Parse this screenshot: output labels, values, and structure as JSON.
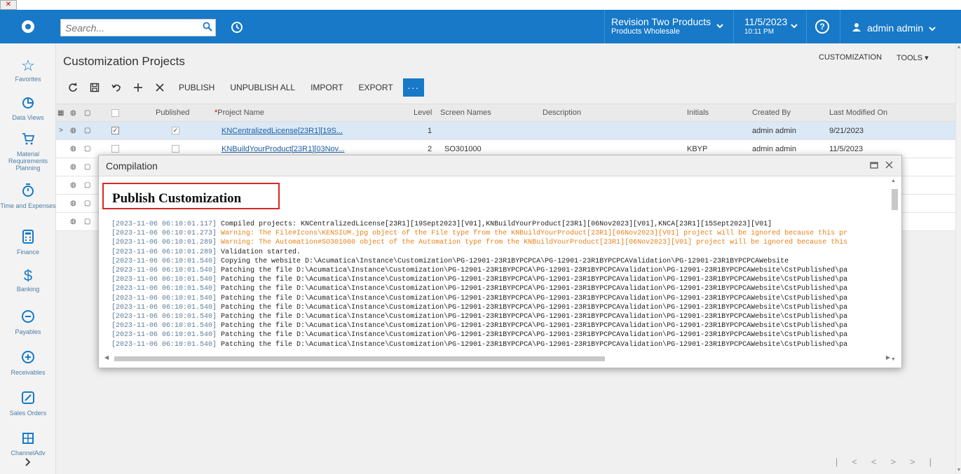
{
  "broken_image": "✕",
  "topbar": {
    "search_placeholder": "Search...",
    "tenant_line1": "Revision Two Products",
    "tenant_line2": "Products Wholesale",
    "date": "11/5/2023",
    "time": "10:11 PM",
    "help": "?",
    "user": "admin admin"
  },
  "sidebar": {
    "items": [
      {
        "label": "Favorites",
        "icon": "star-icon"
      },
      {
        "label": "Data Views",
        "icon": "pie-chart-icon"
      },
      {
        "label": "Material Requirements Planning",
        "icon": "cart-icon"
      },
      {
        "label": "Time and Expenses",
        "icon": "stopwatch-icon"
      },
      {
        "label": "Finance",
        "icon": "calculator-icon"
      },
      {
        "label": "Banking",
        "icon": "dollar-icon"
      },
      {
        "label": "Payables",
        "icon": "minus-circle-icon"
      },
      {
        "label": "Receivables",
        "icon": "plus-circle-icon"
      },
      {
        "label": "Sales Orders",
        "icon": "pencil-icon"
      },
      {
        "label": "ChannelAdv",
        "icon": "grid-icon"
      }
    ]
  },
  "page": {
    "title": "Customization Projects",
    "customization": "CUSTOMIZATION",
    "tools": "TOOLS ▾"
  },
  "toolbar": {
    "publish": "PUBLISH",
    "unpublish_all": "UNPUBLISH ALL",
    "import": "IMPORT",
    "export": "EXPORT",
    "more": "···"
  },
  "grid": {
    "columns": {
      "published": "Published",
      "project_name": "Project Name",
      "level": "Level",
      "screen_names": "Screen Names",
      "description": "Description",
      "initials": "Initials",
      "created_by": "Created By",
      "last_modified": "Last Modified On"
    },
    "rows": [
      {
        "project_name": "KNCentralizedLicense[23R1][19S...",
        "level": "1",
        "screen_names": "",
        "initials": "",
        "created_by": "admin admin",
        "last_modified": "9/21/2023"
      },
      {
        "project_name": "KNBuildYourProduct[23R1][03Nov...",
        "level": "2",
        "screen_names": "SO301000",
        "initials": "KBYP",
        "created_by": "admin admin",
        "last_modified": "11/5/2023"
      }
    ]
  },
  "modal": {
    "title": "Compilation",
    "heading": "Publish Customization",
    "log": [
      {
        "ts": "[2023-11-06 06:10:01.117]",
        "text": " Compiled projects: KNCentralizedLicense[23R1][19Sept2023][V01],KNBuildYourProduct[23R1][06Nov2023][V01],KNCA[23R1][15Sept2023][V01]",
        "warn": false
      },
      {
        "ts": "[2023-11-06 06:10:01.273]",
        "text": " Warning: The File#Icons\\KENSIUM.jpg object of the File type from the KNBuildYourProduct[23R1][06Nov2023][V01] project will be ignored because this pr",
        "warn": true
      },
      {
        "ts": "[2023-11-06 06:10:01.289]",
        "text": " Warning: The Automation#SO301000 object of the Automation type from the KNBuildYourProduct[23R1][06Nov2023][V01] project will be ignored because this",
        "warn": true
      },
      {
        "ts": "[2023-11-06 06:10:01.289]",
        "text": " Validation started.",
        "warn": false
      },
      {
        "ts": "[2023-11-06 06:10:01.540]",
        "text": " Copying the website D:\\Acumatica\\Instance\\Customization\\PG-12901-23R1BYPCPCA\\PG-12901-23R1BYPCPCAValidation\\PG-12901-23R1BYPCPCAWebsite",
        "warn": false
      },
      {
        "ts": "[2023-11-06 06:10:01.540]",
        "text": " Patching the file D:\\Acumatica\\Instance\\Customization\\PG-12901-23R1BYPCPCA\\PG-12901-23R1BYPCPCAValidation\\PG-12901-23R1BYPCPCAWebsite\\CstPublished\\pa",
        "warn": false
      },
      {
        "ts": "[2023-11-06 06:10:01.540]",
        "text": " Patching the file D:\\Acumatica\\Instance\\Customization\\PG-12901-23R1BYPCPCA\\PG-12901-23R1BYPCPCAValidation\\PG-12901-23R1BYPCPCAWebsite\\CstPublished\\pa",
        "warn": false
      },
      {
        "ts": "[2023-11-06 06:10:01.540]",
        "text": " Patching the file D:\\Acumatica\\Instance\\Customization\\PG-12901-23R1BYPCPCA\\PG-12901-23R1BYPCPCAValidation\\PG-12901-23R1BYPCPCAWebsite\\CstPublished\\pa",
        "warn": false
      },
      {
        "ts": "[2023-11-06 06:10:01.540]",
        "text": " Patching the file D:\\Acumatica\\Instance\\Customization\\PG-12901-23R1BYPCPCA\\PG-12901-23R1BYPCPCAValidation\\PG-12901-23R1BYPCPCAWebsite\\CstPublished\\pa",
        "warn": false
      },
      {
        "ts": "[2023-11-06 06:10:01.540]",
        "text": " Patching the file D:\\Acumatica\\Instance\\Customization\\PG-12901-23R1BYPCPCA\\PG-12901-23R1BYPCPCAValidation\\PG-12901-23R1BYPCPCAWebsite\\CstPublished\\pa",
        "warn": false
      },
      {
        "ts": "[2023-11-06 06:10:01.540]",
        "text": " Patching the file D:\\Acumatica\\Instance\\Customization\\PG-12901-23R1BYPCPCA\\PG-12901-23R1BYPCPCAValidation\\PG-12901-23R1BYPCPCAWebsite\\CstPublished\\pa",
        "warn": false
      },
      {
        "ts": "[2023-11-06 06:10:01.540]",
        "text": " Patching the file D:\\Acumatica\\Instance\\Customization\\PG-12901-23R1BYPCPCA\\PG-12901-23R1BYPCPCAValidation\\PG-12901-23R1BYPCPCAWebsite\\CstPublished\\pa",
        "warn": false
      },
      {
        "ts": "[2023-11-06 06:10:01.540]",
        "text": " Patching the file D:\\Acumatica\\Instance\\Customization\\PG-12901-23R1BYPCPCA\\PG-12901-23R1BYPCPCAValidation\\PG-12901-23R1BYPCPCAWebsite\\CstPublished\\pa",
        "warn": false
      },
      {
        "ts": "[2023-11-06 06:10:01.540]",
        "text": " Patching the file D:\\Acumatica\\Instance\\Customization\\PG-12901-23R1BYPCPCA\\PG-12901-23R1BYPCPCAValidation\\PG-12901-23R1BYPCPCAWebsite\\CstPublished\\pa",
        "warn": false
      }
    ]
  },
  "colors": {
    "brand": "#1779c7",
    "warning": "#e8821b",
    "timestamp": "#5d7c9a",
    "highlight_box": "#d62828"
  }
}
